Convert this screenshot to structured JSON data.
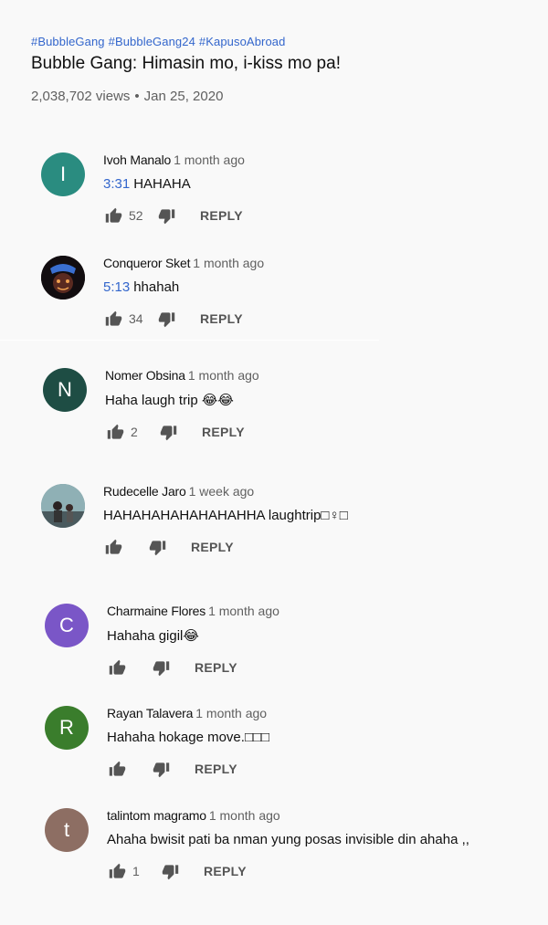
{
  "video": {
    "hashtags": [
      "#BubbleGang",
      "#BubbleGang24",
      "#KapusoAbroad"
    ],
    "title": "Bubble Gang: Himasin mo, i-kiss mo pa!",
    "views": "2,038,702 views",
    "date": "Jan 25, 2020"
  },
  "reply_label": "REPLY",
  "colors": {
    "link": "#3366cc",
    "avatar_ivoh": "#2a8c80",
    "avatar_nomer": "#1e4d44",
    "avatar_charmaine": "#7a56c7",
    "avatar_rayan": "#3a7d2c",
    "avatar_talintom": "#8d6e63"
  },
  "comments": [
    {
      "author": "Ivoh Manalo",
      "time": "1 month ago",
      "timestamp": "3:31",
      "text": "HAHAHA",
      "likes": "52",
      "avatar_letter": "I"
    },
    {
      "author": "Conqueror Sket",
      "time": "1 month ago",
      "timestamp": "5:13",
      "text": "hhahah",
      "likes": "34",
      "avatar_letter": ""
    },
    {
      "author": "Nomer Obsina",
      "time": "1 month ago",
      "timestamp": "",
      "text": "Haha laugh trip 😂😂",
      "likes": "2",
      "avatar_letter": "N"
    },
    {
      "author": "Rudecelle Jaro",
      "time": "1 week ago",
      "timestamp": "",
      "text": "HAHAHAHAHAHAHAHHA laughtrip□♀□",
      "likes": "",
      "avatar_letter": ""
    },
    {
      "author": "Charmaine Flores",
      "time": "1 month ago",
      "timestamp": "",
      "text": "Hahaha gigil😂",
      "likes": "",
      "avatar_letter": "C"
    },
    {
      "author": "Rayan Talavera",
      "time": "1 month ago",
      "timestamp": "",
      "text": "Hahaha hokage move.□□□",
      "likes": "",
      "avatar_letter": "R"
    },
    {
      "author": "talintom magramo",
      "time": "1 month ago",
      "timestamp": "",
      "text": "Ahaha bwisit pati ba nman yung posas invisible din ahaha ,,",
      "likes": "1",
      "avatar_letter": "t"
    }
  ]
}
